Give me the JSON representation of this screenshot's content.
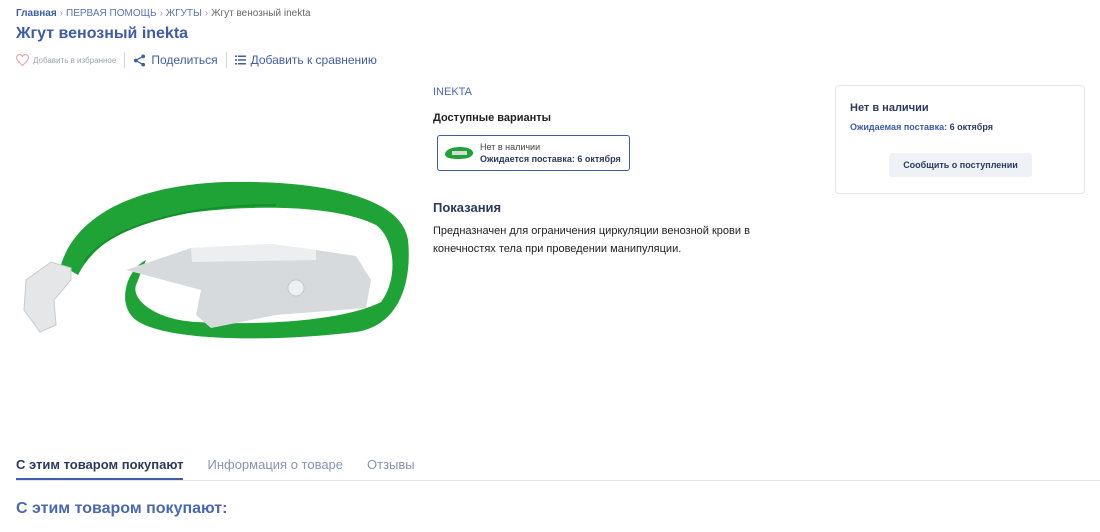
{
  "breadcrumb": {
    "items": [
      "Главная",
      "ПЕРВАЯ ПОМОЩЬ",
      "ЖГУТЫ"
    ],
    "current": "Жгут венозный inekta",
    "separator": "›"
  },
  "product": {
    "title": "Жгут венозный inekta",
    "brand": "INEKTA"
  },
  "actions": {
    "favorite": "Добавить в избранное",
    "share": "Поделиться",
    "compare": "Добавить к сравнению"
  },
  "variants": {
    "title": "Доступные варианты",
    "items": [
      {
        "status": "Нет в наличии",
        "delivery": "Ожидается поставка: 6 октября"
      }
    ]
  },
  "indications": {
    "title": "Показания",
    "text": "Предназначен для ограничения циркуляции венозной крови в конечностях тела при проведении манипуляции."
  },
  "stock": {
    "status": "Нет в наличии",
    "expected_label": "Ожидаемая поставка:",
    "expected_date": "6 октября",
    "notify_button": "Сообщить о поступлении"
  },
  "tabs": [
    {
      "label": "С этим товаром покупают",
      "active": true
    },
    {
      "label": "Информация о товаре",
      "active": false
    },
    {
      "label": "Отзывы",
      "active": false
    }
  ],
  "section": {
    "title": "С этим товаром покупают:"
  },
  "colors": {
    "accent": "#3f5cab",
    "title": "#2b3a5e",
    "product_green": "#1fa336"
  }
}
